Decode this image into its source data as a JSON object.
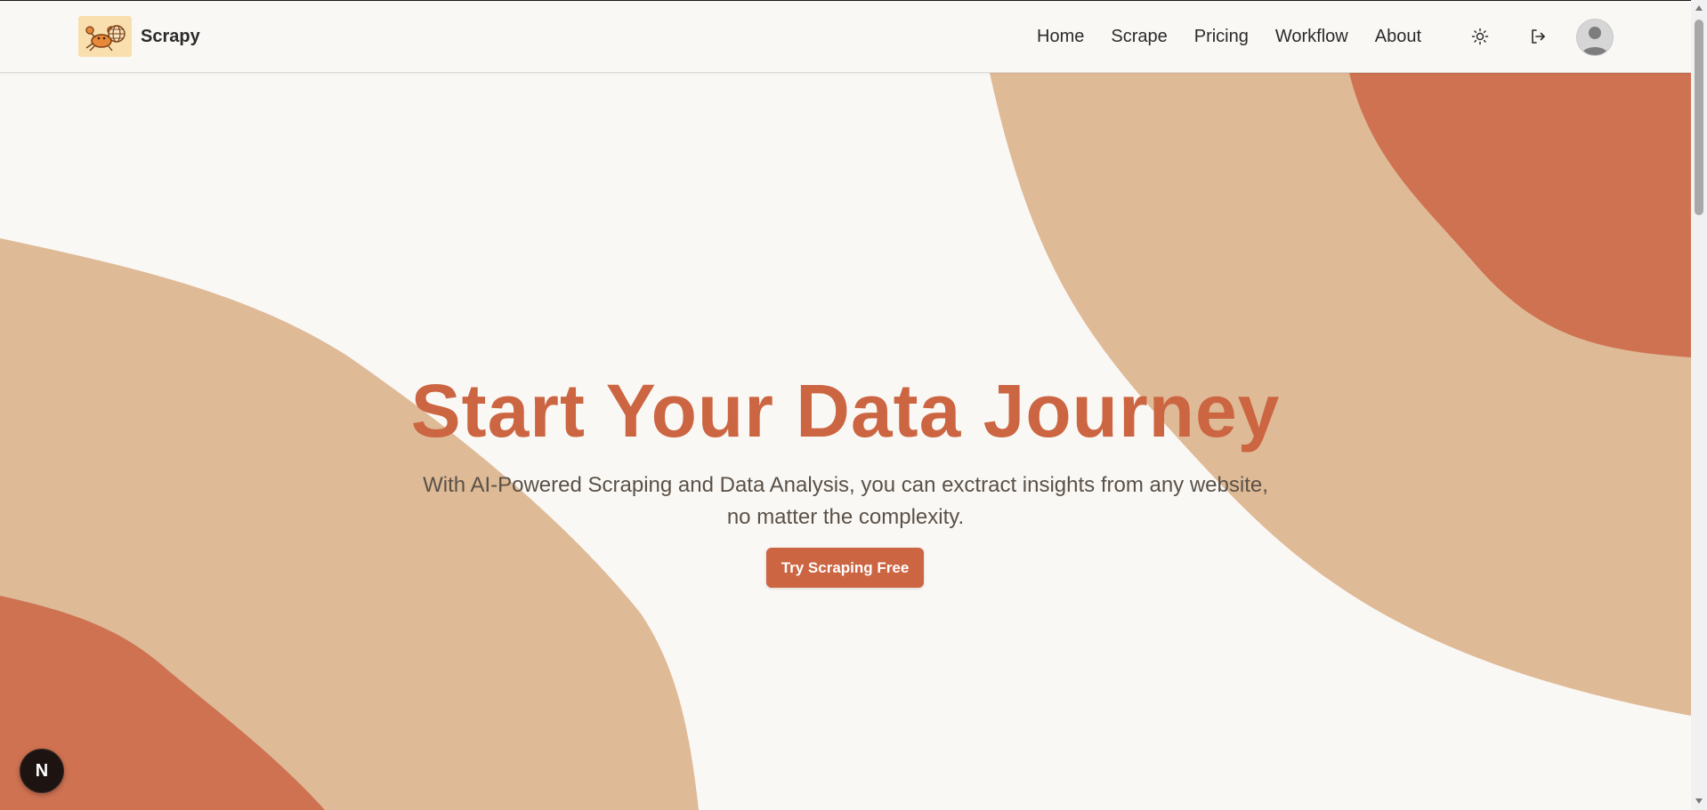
{
  "app": {
    "brand_name": "Scrapy",
    "logo_icon": "crab-globe-icon"
  },
  "nav": {
    "items": [
      {
        "label": "Home"
      },
      {
        "label": "Scrape"
      },
      {
        "label": "Pricing"
      },
      {
        "label": "Workflow"
      },
      {
        "label": "About"
      }
    ],
    "theme_toggle_icon": "sun-icon",
    "logout_icon": "logout-icon",
    "avatar_icon": "user-avatar-icon"
  },
  "hero": {
    "title": "Start Your Data Journey",
    "subtitle": "With AI-Powered Scraping and Data Analysis, you can exctract insights from any website, no matter the complexity.",
    "cta_label": "Try Scraping Free"
  },
  "badge": {
    "label": "N"
  },
  "colors": {
    "accent": "#cc6541",
    "blob_light": "#dfba97",
    "blob_dark": "#cf7252",
    "background": "#faf8f5"
  }
}
